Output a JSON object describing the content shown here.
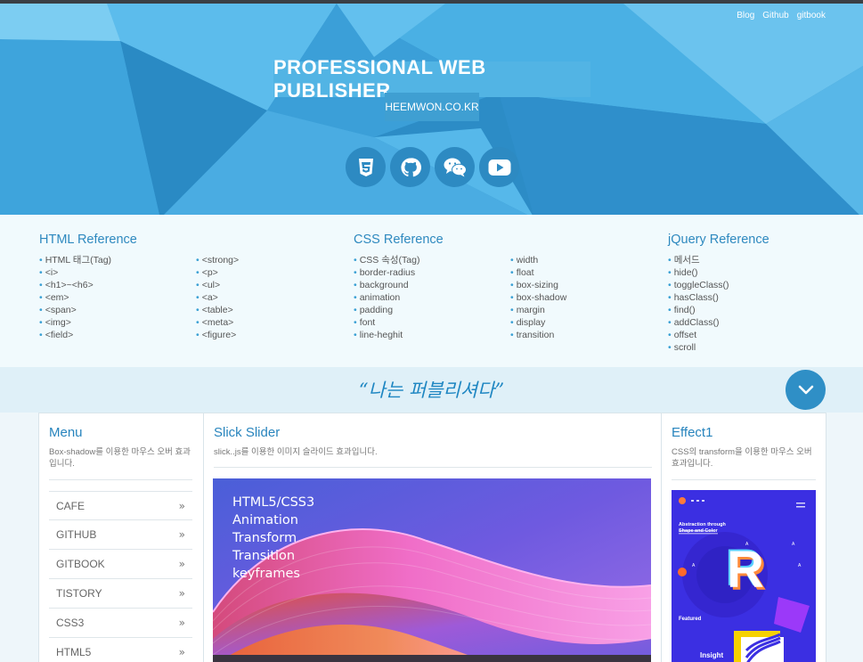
{
  "header": {
    "links": [
      "Blog",
      "Github",
      "gitbook"
    ],
    "title": "PROFESSIONAL WEB PUBLISHER",
    "subtitle": "HEEMWON.CO.KR",
    "social_icons": [
      "css3-icon",
      "github-icon",
      "wechat-icon",
      "youtube-icon"
    ]
  },
  "reference": {
    "html": {
      "title": "HTML Reference",
      "col1": [
        "HTML 태그(Tag)",
        "<i>",
        "<h1>~<h6>",
        "<em>",
        "<span>",
        "<img>",
        "<field>"
      ],
      "col2": [
        "<strong>",
        "<p>",
        "<ul>",
        "<a>",
        "<table>",
        "<meta>",
        "<figure>"
      ]
    },
    "css": {
      "title": "CSS Reference",
      "col1": [
        "CSS 속성(Tag)",
        "border-radius",
        "background",
        "animation",
        "padding",
        "font",
        "line-heghit"
      ],
      "col2": [
        "width",
        "float",
        "box-sizing",
        "box-shadow",
        "margin",
        "display",
        "transition"
      ]
    },
    "jquery": {
      "title": "jQuery Reference",
      "items": [
        "메서드",
        "hide()",
        "toggleClass()",
        "hasClass()",
        "find()",
        "addClass()",
        "offset",
        "scroll"
      ]
    }
  },
  "quote": "“나는 퍼블리셔다”",
  "menu": {
    "title": "Menu",
    "desc": "Box-shadow를 이용한 마우스 오버 효과입니다.",
    "items": [
      "CAFE",
      "GITHUB",
      "GITBOOK",
      "TISTORY",
      "CSS3",
      "HTML5"
    ],
    "arrow": "»"
  },
  "slider": {
    "title": "Slick Slider",
    "desc": "slick..js를 이용한 이미지 슬라이드 효과입니다.",
    "lines": [
      "HTML5/CSS3",
      "Animation",
      "Transform",
      "Transition",
      "keyframes"
    ]
  },
  "effect": {
    "title": "Effect1",
    "desc": "CSS의 transform을 이용한 마우스 오버 효과입니다.",
    "card_heading": "Abstraction through Shape and Color",
    "card_letter": "R",
    "card_featured": "Featured",
    "card_insight": "Insight"
  },
  "colors": {
    "brand_blue": "#2e89bf",
    "header_blue": "#2f8fc8",
    "light_blue": "#52b4e4"
  }
}
